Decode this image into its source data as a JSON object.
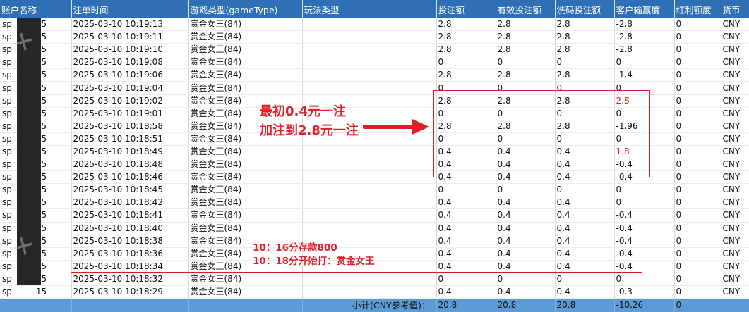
{
  "columns": [
    "账户名称",
    "注单时间",
    "游戏类型(gameType)",
    "玩法类型",
    "投注额",
    "有效投注额",
    "洗码投注额",
    "客户输赢度",
    "红利额度",
    "货币"
  ],
  "rows": [
    {
      "acct_prefix": "sp",
      "acct_suffix": "15",
      "time": "2025-03-10 10:19:13",
      "game": "赏金女王(84)",
      "bet": "2.8",
      "valid": "2.8",
      "wash": "2.8",
      "win": "-2.8",
      "bonus": "0",
      "cur": "CNY"
    },
    {
      "acct_prefix": "sp",
      "acct_suffix": "15",
      "time": "2025-03-10 10:19:11",
      "game": "赏金女王(84)",
      "bet": "2.8",
      "valid": "2.8",
      "wash": "2.8",
      "win": "-2.8",
      "bonus": "0",
      "cur": "CNY"
    },
    {
      "acct_prefix": "sp",
      "acct_suffix": "15",
      "time": "2025-03-10 10:19:10",
      "game": "赏金女王(84)",
      "bet": "2.8",
      "valid": "2.8",
      "wash": "2.8",
      "win": "-2.8",
      "bonus": "0",
      "cur": "CNY"
    },
    {
      "acct_prefix": "sp",
      "acct_suffix": "15",
      "time": "2025-03-10 10:19:08",
      "game": "赏金女王(84)",
      "bet": "0",
      "valid": "0",
      "wash": "0",
      "win": "0",
      "bonus": "0",
      "cur": "CNY"
    },
    {
      "acct_prefix": "sp",
      "acct_suffix": "15",
      "time": "2025-03-10 10:19:06",
      "game": "赏金女王(84)",
      "bet": "2.8",
      "valid": "2.8",
      "wash": "2.8",
      "win": "-1.4",
      "bonus": "0",
      "cur": "CNY"
    },
    {
      "acct_prefix": "sp",
      "acct_suffix": "15",
      "time": "2025-03-10 10:19:04",
      "game": "赏金女王(84)",
      "bet": "0",
      "valid": "0",
      "wash": "0",
      "win": "0",
      "bonus": "0",
      "cur": "CNY"
    },
    {
      "acct_prefix": "sp",
      "acct_suffix": "15",
      "time": "2025-03-10 10:19:02",
      "game": "赏金女王(84)",
      "bet": "2.8",
      "valid": "2.8",
      "wash": "2.8",
      "win": "2.8",
      "win_red": true,
      "bonus": "0",
      "cur": "CNY"
    },
    {
      "acct_prefix": "sp",
      "acct_suffix": "15",
      "time": "2025-03-10 10:19:01",
      "game": "赏金女王(84)",
      "bet": "0",
      "valid": "0",
      "wash": "0",
      "win": "0",
      "bonus": "0",
      "cur": "CNY"
    },
    {
      "acct_prefix": "sp",
      "acct_suffix": "15",
      "time": "2025-03-10 10:18:58",
      "game": "赏金女王(84)",
      "bet": "2.8",
      "valid": "2.8",
      "wash": "2.8",
      "win": "-1.96",
      "bonus": "0",
      "cur": "CNY"
    },
    {
      "acct_prefix": "sp",
      "acct_suffix": "15",
      "time": "2025-03-10 10:18:51",
      "game": "赏金女王(84)",
      "bet": "0",
      "valid": "0",
      "wash": "0",
      "win": "0",
      "bonus": "0",
      "cur": "CNY"
    },
    {
      "acct_prefix": "sp",
      "acct_suffix": "15",
      "time": "2025-03-10 10:18:49",
      "game": "赏金女王(84)",
      "bet": "0.4",
      "valid": "0.4",
      "wash": "0.4",
      "win": "1.8",
      "win_red": true,
      "bonus": "0",
      "cur": "CNY"
    },
    {
      "acct_prefix": "sp",
      "acct_suffix": "15",
      "time": "2025-03-10 10:18:48",
      "game": "赏金女王(84)",
      "bet": "0.4",
      "valid": "0.4",
      "wash": "0.4",
      "win": "-0.4",
      "bonus": "0",
      "cur": "CNY"
    },
    {
      "acct_prefix": "sp",
      "acct_suffix": "15",
      "time": "2025-03-10 10:18:46",
      "game": "赏金女王(84)",
      "bet": "0.4",
      "valid": "0.4",
      "wash": "0.4",
      "win": "-0.4",
      "bonus": "0",
      "cur": "CNY"
    },
    {
      "acct_prefix": "sp",
      "acct_suffix": "15",
      "time": "2025-03-10 10:18:45",
      "game": "赏金女王(84)",
      "bet": "0",
      "valid": "0",
      "wash": "0",
      "win": "0",
      "bonus": "0",
      "cur": "CNY"
    },
    {
      "acct_prefix": "sp",
      "acct_suffix": "15",
      "time": "2025-03-10 10:18:42",
      "game": "赏金女王(84)",
      "bet": "0.4",
      "valid": "0.4",
      "wash": "0.4",
      "win": "0",
      "bonus": "0",
      "cur": "CNY"
    },
    {
      "acct_prefix": "sp",
      "acct_suffix": "15",
      "time": "2025-03-10 10:18:41",
      "game": "赏金女王(84)",
      "bet": "0.4",
      "valid": "0.4",
      "wash": "0.4",
      "win": "-0.4",
      "bonus": "0",
      "cur": "CNY"
    },
    {
      "acct_prefix": "sp",
      "acct_suffix": "15",
      "time": "2025-03-10 10:18:40",
      "game": "赏金女王(84)",
      "bet": "0.4",
      "valid": "0.4",
      "wash": "0.4",
      "win": "-0.4",
      "bonus": "0",
      "cur": "CNY"
    },
    {
      "acct_prefix": "sp",
      "acct_suffix": "15",
      "time": "2025-03-10 10:18:38",
      "game": "赏金女王(84)",
      "bet": "0.4",
      "valid": "0.4",
      "wash": "0.4",
      "win": "-0.4",
      "bonus": "0",
      "cur": "CNY"
    },
    {
      "acct_prefix": "sp",
      "acct_suffix": "15",
      "time": "2025-03-10 10:18:36",
      "game": "赏金女王(84)",
      "bet": "0.4",
      "valid": "0.4",
      "wash": "0.4",
      "win": "-0.4",
      "bonus": "0",
      "cur": "CNY"
    },
    {
      "acct_prefix": "sp",
      "acct_suffix": "15",
      "time": "2025-03-10 10:18:34",
      "game": "赏金女王(84)",
      "bet": "0.4",
      "valid": "0.4",
      "wash": "0.4",
      "win": "-0.4",
      "bonus": "0",
      "cur": "CNY"
    },
    {
      "acct_prefix": "sp",
      "acct_suffix": "15",
      "time": "2025-03-10 10:18:32",
      "game": "赏金女王(84)",
      "bet": "0",
      "valid": "0",
      "wash": "0",
      "win": "0",
      "bonus": "0",
      "cur": "CNY"
    },
    {
      "acct_prefix": "sp",
      "acct_suffix": "15",
      "time": "2025-03-10 10:18:29",
      "game": "赏金女王(84)",
      "bet": "0.4",
      "valid": "0.4",
      "wash": "0.4",
      "win": "-0.3",
      "bonus": "0",
      "cur": "CNY"
    }
  ],
  "subtotal": {
    "label": "小计(CNY参考值)：",
    "bet": "20.8",
    "valid": "20.8",
    "wash": "20.8",
    "win": "-10.26",
    "bonus": "0"
  },
  "annotations": {
    "main_line1": "最初0.4元一注",
    "main_line2": "加注到2.8元一注",
    "note_line1": "10：16分存款800",
    "note_line2": "10：18分开始打：赏金女王"
  },
  "colors": {
    "header_bg": "#2f6fb5",
    "subtotal_bg": "#5c9bd6",
    "annotation_red": "#e41d2a"
  }
}
